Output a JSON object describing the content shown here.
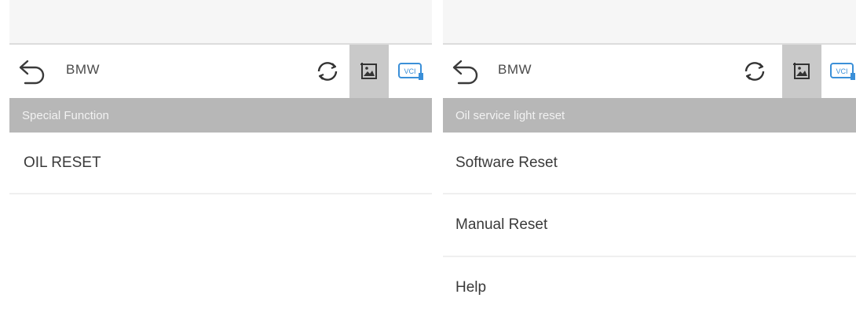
{
  "panels": [
    {
      "header": {
        "brand": "BMW",
        "back_icon": "back-arrow-icon",
        "refresh_icon": "refresh-icon",
        "screenshot_icon": "screenshot-icon",
        "vci_icon": "vci-icon",
        "vci_label": "VCI"
      },
      "section_title": "Special Function",
      "items": [
        {
          "label": "OIL RESET"
        }
      ]
    },
    {
      "header": {
        "brand": "BMW",
        "back_icon": "back-arrow-icon",
        "refresh_icon": "refresh-icon",
        "screenshot_icon": "screenshot-icon",
        "vci_icon": "vci-icon",
        "vci_label": "VCI"
      },
      "section_title": "Oil service light reset",
      "items": [
        {
          "label": "Software Reset"
        },
        {
          "label": "Manual Reset"
        },
        {
          "label": "Help"
        }
      ]
    }
  ],
  "colors": {
    "section_header_bg": "#b7b7b7",
    "active_tool_bg": "#c9c9c9",
    "vci_accent": "#3a8fd8"
  }
}
